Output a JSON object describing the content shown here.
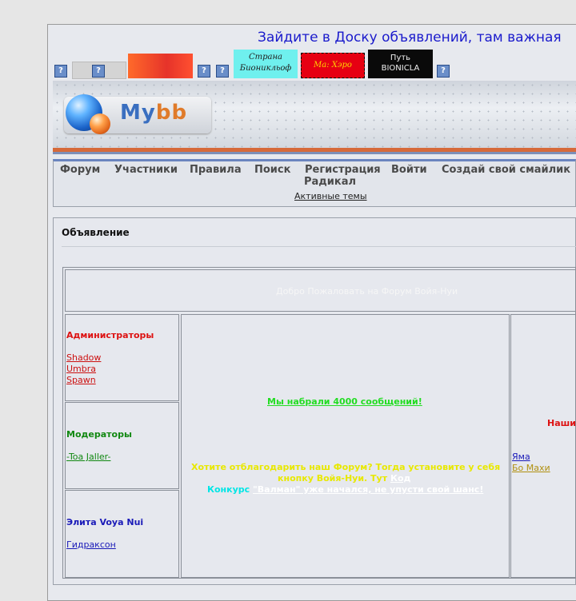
{
  "marquee_text": "Зайдите в Доску объявлений, там важная",
  "banners": {
    "cyan_text": "Страна\nБионикльоф",
    "red_text": "Ма: Хэро",
    "black_text": "Путь\nBIONICLA"
  },
  "icons": {
    "question": "?"
  },
  "logo": {
    "my": "My",
    "bb": "bb"
  },
  "nav": {
    "items": [
      "Форум",
      "Участники",
      "Правила",
      "Поиск",
      "Регистрация",
      "Войти",
      "Создай свой смайлик",
      "Радикал"
    ],
    "active_topics": "Активные темы"
  },
  "announcement": {
    "title": "Объявление",
    "welcome": "Добро Пожаловать на Форум Войя-Нуи"
  },
  "groups": {
    "admins": {
      "title": "Администраторы",
      "members": [
        "Shadow",
        "Umbra",
        "Spawn"
      ]
    },
    "mods": {
      "title": "Модераторы",
      "members": [
        "-Toa Jaller-"
      ]
    },
    "elite": {
      "title": "Элита Voya Nui",
      "members": [
        "Гидраксон"
      ]
    },
    "right": {
      "title_fragment": "Наши",
      "members": [
        "Яма",
        "Бо Махи"
      ]
    }
  },
  "center": {
    "msg_4000": "Мы набрали 4000 сообщений!",
    "thanks_line1": "Хотите отблагодарить наш Форум? Тогда установите у себя",
    "thanks_line2": "кнопку Войя-Нуи. Тут",
    "thanks_code": "Код",
    "contest_label": "Конкурс",
    "contest_text": "\"Валман\" уже начался, не упусти свой шанс!"
  },
  "colors": {
    "admin": "#dd1111",
    "mod": "#118811",
    "elite": "#1a1ab8",
    "green_msg": "#22dd22",
    "yellow_msg": "#e8e800",
    "cyan_msg": "#00e6e6"
  }
}
